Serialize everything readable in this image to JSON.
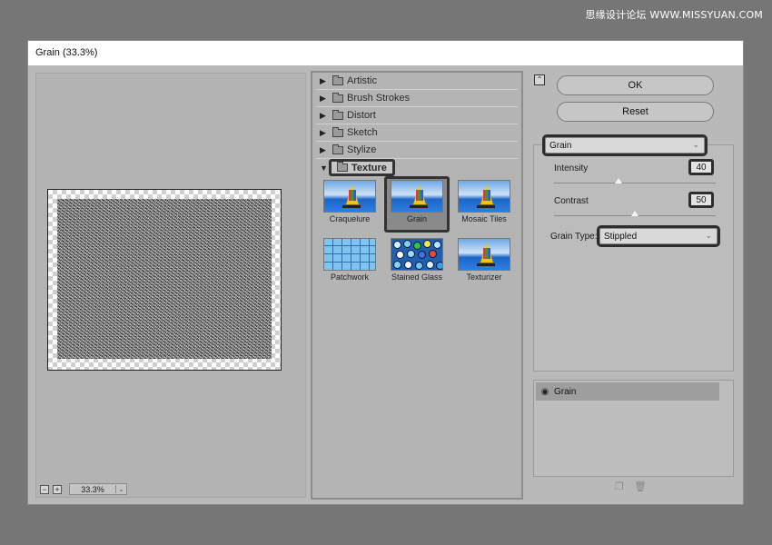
{
  "watermark": "思缘设计论坛 WWW.MISSYUAN.COM",
  "window": {
    "title": "Grain (33.3%)"
  },
  "preview": {
    "zoom_minus": "−",
    "zoom_plus": "+",
    "zoom_value": "33.3%",
    "zoom_arrow": "⌄"
  },
  "gallery": {
    "categories": [
      {
        "label": "Artistic"
      },
      {
        "label": "Brush Strokes"
      },
      {
        "label": "Distort"
      },
      {
        "label": "Sketch"
      },
      {
        "label": "Stylize"
      }
    ],
    "open_category": "Texture",
    "filters": [
      {
        "label": "Craquelure"
      },
      {
        "label": "Grain"
      },
      {
        "label": "Mosaic Tiles"
      },
      {
        "label": "Patchwork"
      },
      {
        "label": "Stained Glass"
      },
      {
        "label": "Texturizer"
      }
    ]
  },
  "actions": {
    "ok_label": "OK",
    "reset_label": "Reset"
  },
  "settings": {
    "filter_select": "Grain",
    "intensity": {
      "label": "Intensity",
      "value": "40",
      "fraction": 0.4
    },
    "contrast": {
      "label": "Contrast",
      "value": "50",
      "fraction": 0.5
    },
    "grain_type": {
      "label": "Grain Type:",
      "value": "Stippled"
    }
  },
  "layers": [
    {
      "label": "Grain"
    }
  ],
  "colors": {
    "background": "#767676",
    "dialog": "#b9b9b9",
    "highlight": "#2d2d2d"
  }
}
